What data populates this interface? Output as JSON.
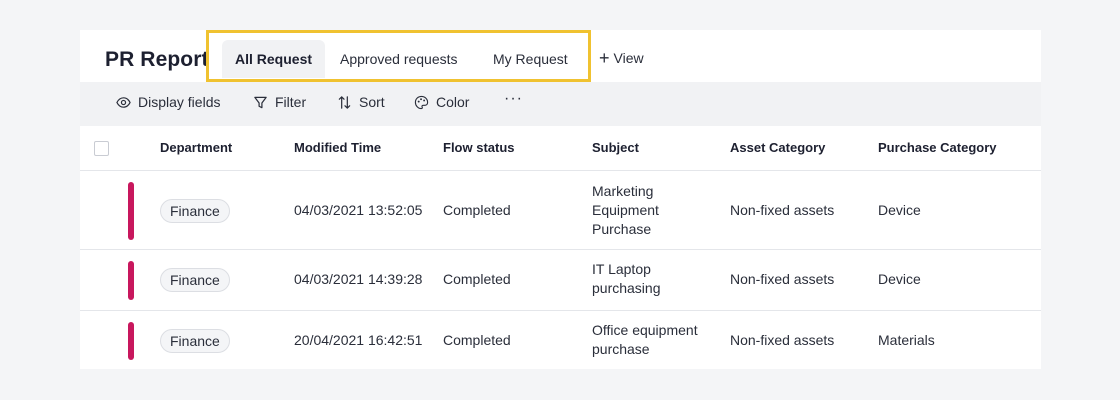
{
  "header": {
    "title": "PR Report",
    "tabs": [
      {
        "label": "All Request"
      },
      {
        "label": "Approved requests"
      },
      {
        "label": "My Request"
      }
    ],
    "add_view_label": "View"
  },
  "toolbar": {
    "display_fields": "Display fields",
    "filter": "Filter",
    "sort": "Sort",
    "color": "Color",
    "more": "···"
  },
  "table": {
    "columns": [
      "Department",
      "Modified Time",
      "Flow status",
      "Subject",
      "Asset Category",
      "Purchase Category"
    ],
    "rows": [
      {
        "department": "Finance",
        "modified_time": "04/03/2021 13:52:05",
        "flow_status": "Completed",
        "subject_lines": [
          "Marketing",
          "Equipment",
          "Purchase"
        ],
        "asset_category": "Non-fixed assets",
        "purchase_category": "Device"
      },
      {
        "department": "Finance",
        "modified_time": "04/03/2021 14:39:28",
        "flow_status": "Completed",
        "subject_lines": [
          "IT Laptop",
          "purchasing"
        ],
        "asset_category": "Non-fixed assets",
        "purchase_category": "Device"
      },
      {
        "department": "Finance",
        "modified_time": "20/04/2021 16:42:51",
        "flow_status": "Completed",
        "subject_lines": [
          "Office equipment",
          "purchase"
        ],
        "asset_category": "Non-fixed assets",
        "purchase_category": "Materials"
      }
    ]
  },
  "colors": {
    "accent_highlight": "#f0c230",
    "row_marker": "#c8175d",
    "page_background": "#f4f5f7"
  },
  "icons": {
    "display_fields": "eye-icon",
    "filter": "filter-icon",
    "sort": "sort-icon",
    "color": "palette-icon",
    "add_view": "plus-icon"
  }
}
